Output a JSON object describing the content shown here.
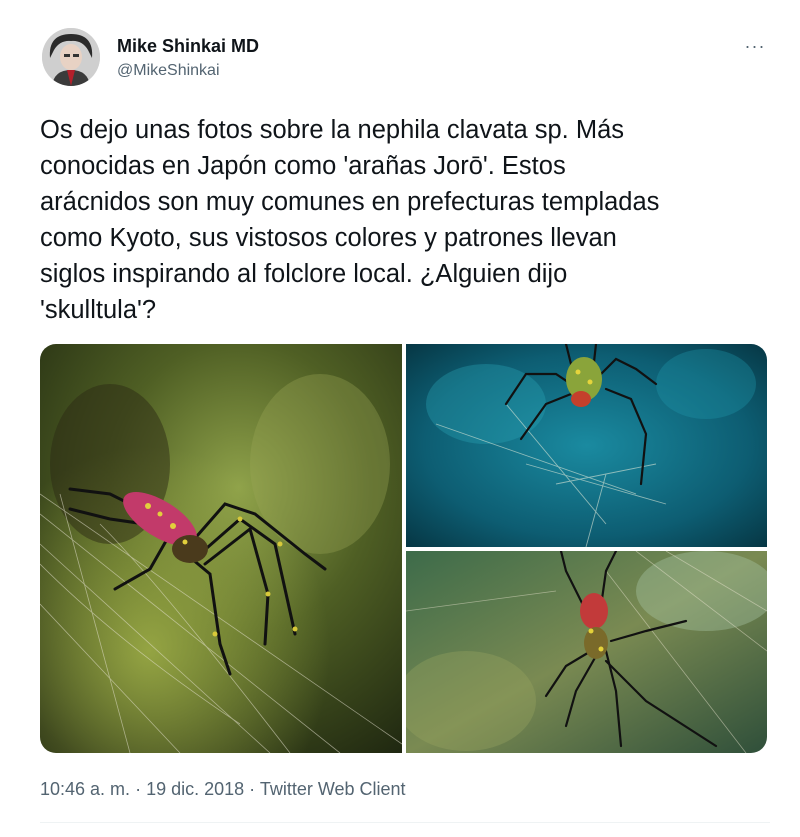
{
  "user": {
    "display_name": "Mike Shinkai MD",
    "handle": "@MikeShinkai"
  },
  "more_icon": "more-horizontal-icon",
  "more_label": "···",
  "tweet": {
    "text": "Os dejo unas fotos sobre la nephila clavata sp. Más\nconocidas en Japón como 'arañas Jorō'. Estos\narácnidos son muy comunes en prefecturas templadas\ncomo Kyoto, sus vistosos colores y patrones llevan\nsiglos inspirando al folclore local. ¿Alguien dijo\n'skulltula'?"
  },
  "meta": {
    "time": "10:46 a. m.",
    "sep1": " · ",
    "date": "19 dic. 2018",
    "sep2": " · ",
    "client": "Twitter Web Client"
  },
  "colors": {
    "text": "#0f1419",
    "secondary": "#536471",
    "divider": "#eff3f4"
  }
}
